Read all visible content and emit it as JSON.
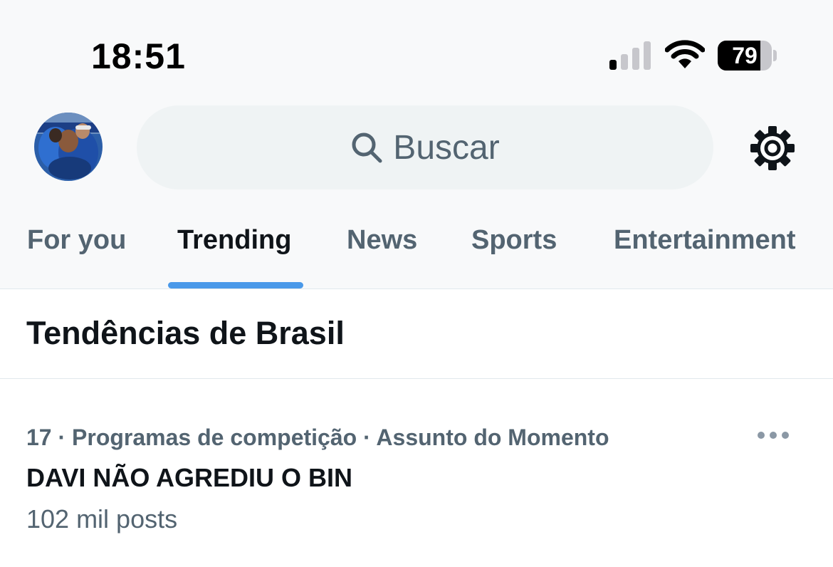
{
  "status_bar": {
    "time": "18:51",
    "battery_level": 79,
    "battery_label": "79",
    "signal_bars_active": 1,
    "signal_bars_total": 4
  },
  "header": {
    "avatar_icon": "profile-photo-avatar",
    "search": {
      "placeholder": "Buscar",
      "icon": "search-icon"
    },
    "settings_icon": "gear-icon"
  },
  "tabs": {
    "items": [
      {
        "label": "For you",
        "active": false
      },
      {
        "label": "Trending",
        "active": true
      },
      {
        "label": "News",
        "active": false
      },
      {
        "label": "Sports",
        "active": false
      },
      {
        "label": "Entertainment",
        "active": false
      }
    ],
    "accent_color": "#4a99e9"
  },
  "section": {
    "title": "Tendências de Brasil"
  },
  "trends": [
    {
      "meta": "17 · Programas de competição · Assunto do Momento",
      "title": "DAVI NÃO AGREDIU O BIN",
      "count": "102 mil posts",
      "more_icon": "more-horizontal-icon"
    }
  ]
}
